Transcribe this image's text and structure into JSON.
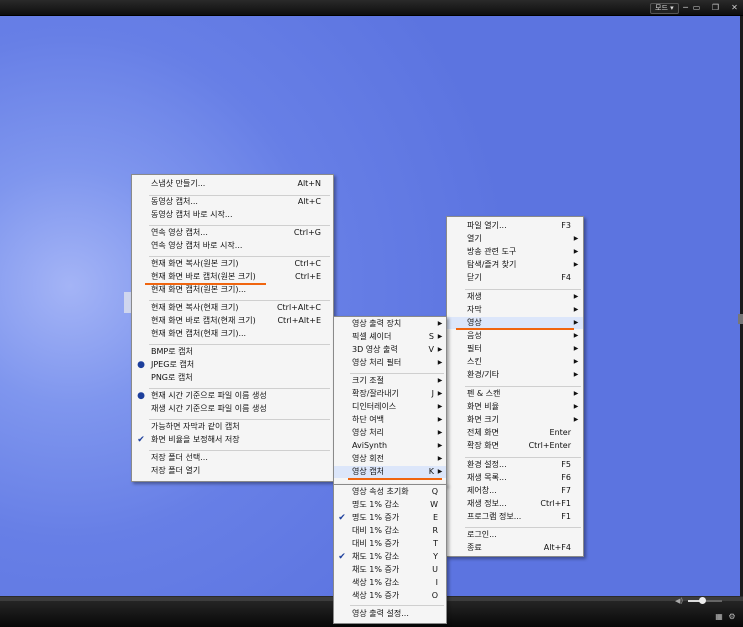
{
  "titlebar": {
    "mode_label": "모드",
    "mode_arrow": "▾",
    "buttons": [
      "─",
      "▭",
      "❐",
      "✕"
    ]
  },
  "volume": {
    "level_percent": 40
  },
  "capture_menu": {
    "items": [
      {
        "label": "스냅샷 만들기...",
        "shortcut": "Alt+N"
      },
      {
        "label": "동영상 캡처...",
        "shortcut": "Alt+C"
      },
      {
        "label": "동영상 캡처 바로 시작...",
        "shortcut": ""
      },
      {
        "label": "연속 영상 캡처...",
        "shortcut": "Ctrl+G"
      },
      {
        "label": "연속 영상 캡처 바로 시작...",
        "shortcut": ""
      },
      {
        "label": "현재 화면 복사(원본 크기)",
        "shortcut": "Ctrl+C"
      },
      {
        "label": "현재 화면 바로 캡처(원본 크기)",
        "shortcut": "Ctrl+E"
      },
      {
        "label": "현재 화면 캡처(원본 크기)...",
        "shortcut": ""
      },
      {
        "label": "현재 화면 복사(현재 크기)",
        "shortcut": "Ctrl+Alt+C"
      },
      {
        "label": "현재 화면 바로 캡처(현재 크기)",
        "shortcut": "Ctrl+Alt+E"
      },
      {
        "label": "현재 화면 캡처(현재 크기)...",
        "shortcut": ""
      },
      {
        "label": "BMP로 캡처",
        "shortcut": ""
      },
      {
        "label": "JPEG로 캡처",
        "shortcut": ""
      },
      {
        "label": "PNG로 캡처",
        "shortcut": ""
      },
      {
        "label": "현재 시간 기준으로 파일 이름 생성",
        "shortcut": ""
      },
      {
        "label": "재생 시간 기준으로 파일 이름 생성",
        "shortcut": ""
      },
      {
        "label": "가능하면 자막과 같이 캡처",
        "shortcut": ""
      },
      {
        "label": "화면 비율을 보정해서 저장",
        "shortcut": ""
      },
      {
        "label": "저장 폴더 선택...",
        "shortcut": ""
      },
      {
        "label": "저장 폴더 열기",
        "shortcut": ""
      }
    ],
    "marks": {
      "bullet": "●",
      "check": "✔"
    }
  },
  "main_menu": {
    "items": [
      {
        "label": "파일 열기...",
        "shortcut": "F3"
      },
      {
        "label": "열기",
        "shortcut": ""
      },
      {
        "label": "방송 관련 도구",
        "shortcut": ""
      },
      {
        "label": "탐색/즐겨 찾기",
        "shortcut": ""
      },
      {
        "label": "닫기",
        "shortcut": "F4"
      },
      {
        "label": "재생",
        "shortcut": ""
      },
      {
        "label": "자막",
        "shortcut": ""
      },
      {
        "label": "영상",
        "shortcut": ""
      },
      {
        "label": "음성",
        "shortcut": ""
      },
      {
        "label": "필터",
        "shortcut": ""
      },
      {
        "label": "스킨",
        "shortcut": ""
      },
      {
        "label": "환경/기타",
        "shortcut": ""
      },
      {
        "label": "펜 & 스캔",
        "shortcut": ""
      },
      {
        "label": "화면 비율",
        "shortcut": ""
      },
      {
        "label": "화면 크기",
        "shortcut": ""
      },
      {
        "label": "전체 화면",
        "shortcut": "Enter"
      },
      {
        "label": "확장 화면",
        "shortcut": "Ctrl+Enter"
      },
      {
        "label": "환경 설정...",
        "shortcut": "F5"
      },
      {
        "label": "재생 목록...",
        "shortcut": "F6"
      },
      {
        "label": "제어창...",
        "shortcut": "F7"
      },
      {
        "label": "재생 정보...",
        "shortcut": "Ctrl+F1"
      },
      {
        "label": "프로그램 정보...",
        "shortcut": "F1"
      },
      {
        "label": "로그인...",
        "shortcut": ""
      },
      {
        "label": "종료",
        "shortcut": "Alt+F4"
      }
    ],
    "arrow": "▶"
  },
  "video_menu": {
    "items": [
      {
        "label": "영상 출력 장치",
        "shortcut": ""
      },
      {
        "label": "픽셀 셰이더",
        "shortcut": "S"
      },
      {
        "label": "3D 영상 출력",
        "shortcut": "V"
      },
      {
        "label": "영상 처리 필터",
        "shortcut": ""
      },
      {
        "label": "크기 조절",
        "shortcut": ""
      },
      {
        "label": "확장/잘라내기",
        "shortcut": "J"
      },
      {
        "label": "디인터레이스",
        "shortcut": ""
      },
      {
        "label": "하단 여백",
        "shortcut": ""
      },
      {
        "label": "영상 처리",
        "shortcut": ""
      },
      {
        "label": "AviSynth",
        "shortcut": ""
      },
      {
        "label": "영상 회전",
        "shortcut": ""
      },
      {
        "label": "영상 캡처",
        "shortcut": "K"
      }
    ],
    "arrow": "▶"
  },
  "adjust_menu": {
    "items": [
      {
        "label": "영상 속성 초기화",
        "shortcut": "Q"
      },
      {
        "label": "명도 1% 감소",
        "shortcut": "W"
      },
      {
        "label": "명도 1% 증가",
        "shortcut": "E"
      },
      {
        "label": "대비 1% 감소",
        "shortcut": "R"
      },
      {
        "label": "대비 1% 증가",
        "shortcut": "T"
      },
      {
        "label": "채도 1% 감소",
        "shortcut": "Y"
      },
      {
        "label": "채도 1% 증가",
        "shortcut": "U"
      },
      {
        "label": "색상 1% 감소",
        "shortcut": "I"
      },
      {
        "label": "색상 1% 증가",
        "shortcut": "O"
      },
      {
        "label": "영상 출력 설정...",
        "shortcut": ""
      }
    ],
    "check": "✔"
  }
}
